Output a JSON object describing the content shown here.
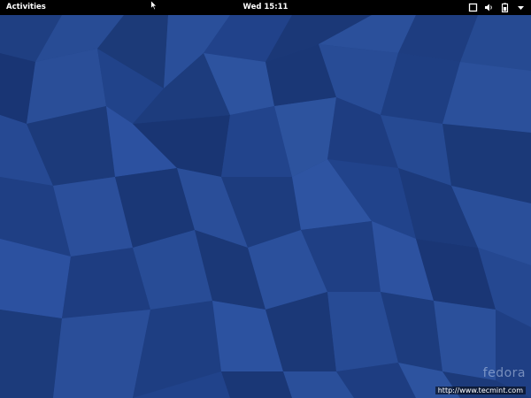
{
  "topbar": {
    "activities_label": "Activities",
    "clock": "Wed 15:11",
    "tray_icons": [
      "window-icon",
      "volume-icon",
      "battery-icon",
      "dropdown-arrow-icon"
    ]
  },
  "desktop": {
    "wallpaper": "fedora-blue-polygons",
    "colors": {
      "base": "#23458a",
      "dark": "#1a3470",
      "light": "#2e55a0",
      "topbar": "#000000"
    }
  },
  "watermark": {
    "brand": "fedora",
    "url": "http://www.tecmint.com"
  }
}
